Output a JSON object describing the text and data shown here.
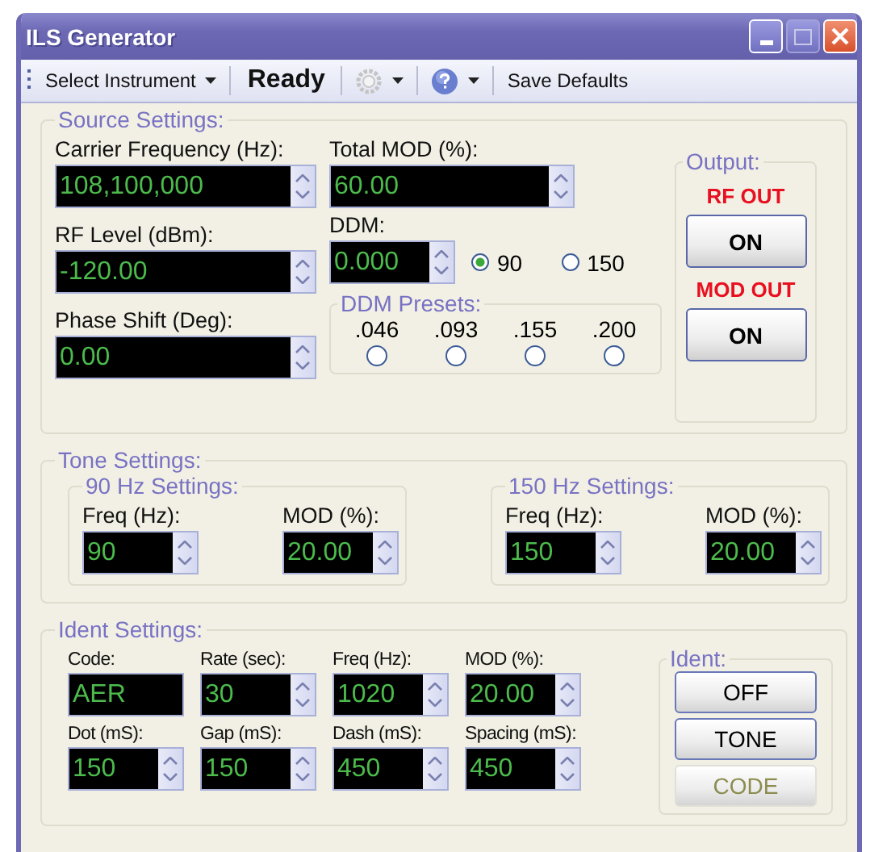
{
  "window": {
    "title": "ILS Generator"
  },
  "toolbar": {
    "instrument_menu": "Select Instrument",
    "status": "Ready",
    "save_button": "Save Defaults"
  },
  "source": {
    "title": "Source Settings:",
    "carrier": {
      "label": "Carrier Frequency (Hz):",
      "value": "108,100,000"
    },
    "total_mod": {
      "label": "Total MOD (%):",
      "value": "60.00"
    },
    "rf_level": {
      "label": "RF Level (dBm):",
      "value": "-120.00"
    },
    "ddm": {
      "label": "DDM:",
      "value": "0.000"
    },
    "ddm_tones": [
      {
        "label": "90",
        "selected": true
      },
      {
        "label": "150",
        "selected": false
      }
    ],
    "phase": {
      "label": "Phase Shift (Deg):",
      "value": "0.00"
    },
    "presets": {
      "title": "DDM Presets:",
      "options": [
        {
          "label": ".046",
          "selected": false
        },
        {
          "label": ".093",
          "selected": false
        },
        {
          "label": ".155",
          "selected": false
        },
        {
          "label": ".200",
          "selected": false
        }
      ]
    }
  },
  "output": {
    "title": "Output:",
    "channels": [
      {
        "label": "RF OUT",
        "button": "ON"
      },
      {
        "label": "MOD OUT",
        "button": "ON"
      }
    ]
  },
  "tone": {
    "title": "Tone Settings:",
    "groups": [
      {
        "title": "90 Hz Settings:",
        "fields": [
          {
            "label": "Freq (Hz):",
            "value": "90"
          },
          {
            "label": "MOD (%):",
            "value": "20.00"
          }
        ]
      },
      {
        "title": "150 Hz Settings:",
        "fields": [
          {
            "label": "Freq (Hz):",
            "value": "150"
          },
          {
            "label": "MOD (%):",
            "value": "20.00"
          }
        ]
      }
    ]
  },
  "ident": {
    "title": "Ident Settings:",
    "fields": [
      {
        "kind": "text",
        "label": "Code:",
        "value": "AER"
      },
      {
        "kind": "spin",
        "label": "Rate (sec):",
        "value": "30"
      },
      {
        "kind": "spin",
        "label": "Freq (Hz):",
        "value": "1020"
      },
      {
        "kind": "spin",
        "label": "MOD (%):",
        "value": "20.00"
      },
      {
        "kind": "spin",
        "label": "Dot (mS):",
        "value": "150"
      },
      {
        "kind": "spin",
        "label": "Gap (mS):",
        "value": "150"
      },
      {
        "kind": "spin",
        "label": "Dash (mS):",
        "value": "450"
      },
      {
        "kind": "spin",
        "label": "Spacing (mS):",
        "value": "450"
      }
    ],
    "buttons_title": "Ident:",
    "buttons": [
      {
        "label": "OFF",
        "disabled": false
      },
      {
        "label": "TONE",
        "disabled": false
      },
      {
        "label": "CODE",
        "disabled": true
      }
    ]
  }
}
